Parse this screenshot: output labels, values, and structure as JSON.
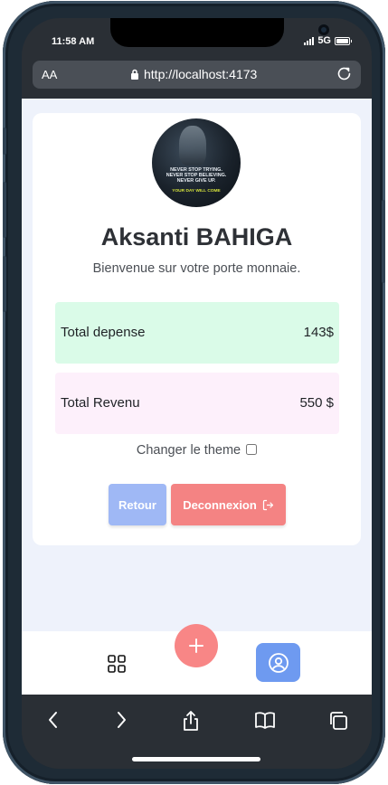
{
  "status": {
    "time": "11:58 AM",
    "network": "5G"
  },
  "browser": {
    "text_size_label": "AA",
    "url": "http://localhost:4173"
  },
  "profile": {
    "avatar_quote_lines": [
      "NEVER STOP TRYING.",
      "NEVER STOP BELIEVING.",
      "NEVER GIVE UP."
    ],
    "avatar_footer": "YOUR DAY WILL COME",
    "name": "Aksanti BAHIGA",
    "welcome": "Bienvenue sur votre porte monnaie."
  },
  "totals": {
    "expense_label": "Total depense",
    "expense_value": "143$",
    "income_label": "Total Revenu",
    "income_value": "550 $"
  },
  "theme": {
    "label": "Changer le theme",
    "checked": false
  },
  "actions": {
    "back_label": "Retour",
    "logout_label": "Deconnexion"
  },
  "colors": {
    "page_bg": "#eef2fb",
    "expense_bg": "#dafbe8",
    "income_bg": "#fdf0fb",
    "back_button": "#9fb8f5",
    "logout_button": "#f48383",
    "fab": "#f88686",
    "profile_tab": "#6e9af0"
  }
}
